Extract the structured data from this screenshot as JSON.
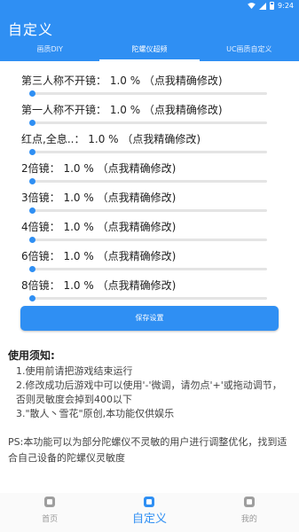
{
  "status_bar": {
    "time": "9:24"
  },
  "app_bar": {
    "title": "自定义"
  },
  "tabs": [
    {
      "label": "画质DIY",
      "active": false
    },
    {
      "label": "陀螺仪超频",
      "active": true
    },
    {
      "label": "UC画质自定义",
      "active": false
    }
  ],
  "settings": [
    {
      "label": "第三人称不开镜： 1.0 % （点我精确修改)",
      "value_percent": 1.0
    },
    {
      "label": "第一人称不开镜： 1.0 % （点我精确修改)",
      "value_percent": 1.0
    },
    {
      "label": "红点,全息..： 1.0 % （点我精确修改)",
      "value_percent": 1.0
    },
    {
      "label": "2倍镜： 1.0 % （点我精确修改)",
      "value_percent": 1.0
    },
    {
      "label": "3倍镜： 1.0 % （点我精确修改)",
      "value_percent": 1.0
    },
    {
      "label": "4倍镜： 1.0 % （点我精确修改)",
      "value_percent": 1.0
    },
    {
      "label": "6倍镜： 1.0 % （点我精确修改)",
      "value_percent": 1.0
    },
    {
      "label": "8倍镜： 1.0 % （点我精确修改)",
      "value_percent": 1.0
    }
  ],
  "save_button": {
    "label": "保存设置"
  },
  "notes": {
    "heading": "使用须知:",
    "items": [
      "1.使用前请把游戏结束运行",
      "2.修改成功后游戏中可以使用'-'微调，请勿点'+'或拖动调节，",
      "否则灵敏度会掉到400以下",
      "3.\"散人丶雪花\"原创,本功能仅供娱乐"
    ],
    "ps": "PS:本功能可以为部分陀螺仪不灵敏的用户进行调整优化，找到适合自己设备的陀螺仪灵敏度"
  },
  "bottom_nav": [
    {
      "label": "首页",
      "icon": "home-icon",
      "active": false
    },
    {
      "label": "自定义",
      "icon": "customize-icon",
      "active": true
    },
    {
      "label": "我的",
      "icon": "profile-icon",
      "active": false
    }
  ],
  "colors": {
    "accent": "#2f8ff3",
    "track": "#e4e4e4"
  }
}
